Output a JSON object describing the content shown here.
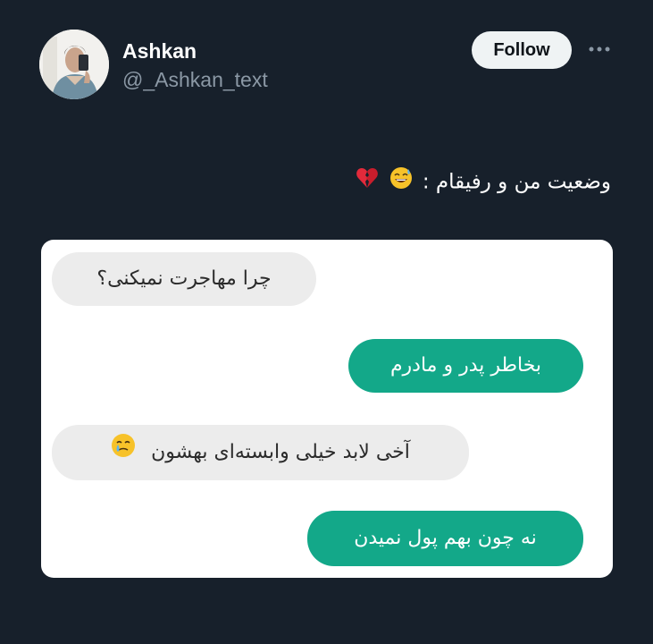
{
  "tweet": {
    "author_name": "Ashkan",
    "author_handle": "@_Ashkan_text",
    "follow_label": "Follow",
    "text": "وضعیت من و رفیقام :",
    "text_emojis": [
      "grinning-sweat-emoji",
      "broken-heart-emoji"
    ]
  },
  "media": {
    "messages": [
      {
        "side": "incoming",
        "text": "چرا مهاجرت نمیکنی؟"
      },
      {
        "side": "outgoing",
        "text": "بخاطر پدر و مادرم"
      },
      {
        "side": "incoming",
        "text": "آخی لابد خیلی وابسته‌ای بهشون",
        "emoji": "crying-smile-emoji"
      },
      {
        "side": "outgoing",
        "text": "نه چون بهم پول نمیدن"
      }
    ]
  },
  "colors": {
    "background": "#17202b",
    "outgoing_bubble": "#13a889",
    "incoming_bubble": "#ececec",
    "follow_button": "#eff3f4",
    "handle_text": "#8b98a5"
  }
}
